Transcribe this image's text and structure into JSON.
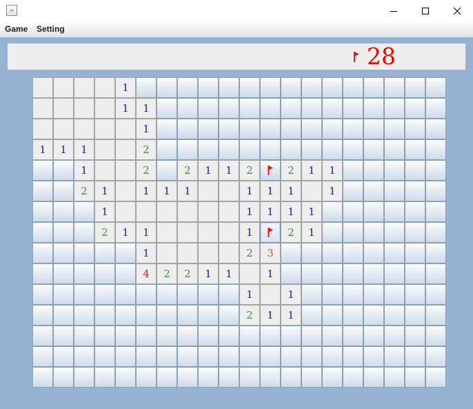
{
  "window": {
    "app_icon": "java-coffee-cup-icon",
    "controls": [
      "minimize-icon",
      "maximize-icon",
      "close-icon"
    ]
  },
  "menu": {
    "items": [
      "Game",
      "Setting"
    ]
  },
  "status": {
    "flag_icon": "red-flag-icon",
    "mines_remaining": "28"
  },
  "board": {
    "columns": 20,
    "rows": 15,
    "legend": "c = covered tile, f = flagged tile, . = opened empty tile, 1-8 = adjacent mine count",
    "cells": [
      "....1ccccccccccccccc",
      "....11cccccccccccccc",
      ".....1cccccccccccccc",
      "111..2cccccccccccccc",
      "cc1..2c2112f211ccccc",
      "cc21.111..111.1ccccc",
      "ccc1......1111cccccc",
      "ccc211....1f21cccccc",
      "ccccc1....23cccccccc",
      "ccccc42211.1cccccccc",
      "cccccccccc1.1ccccccc",
      "cccccccccc211ccccccc",
      "cccccccccccccccccccc",
      "cccccccccccccccccccc",
      "cccccccccccccccccccc"
    ],
    "pressed_tile": "row 8, column 12",
    "colors": {
      "1": "#1b1ba6",
      "2": "#2d9b2d",
      "3": "#c4612a",
      "4": "#e21d1d",
      "flag": "#e8141a",
      "background": "#97b2d0"
    }
  }
}
